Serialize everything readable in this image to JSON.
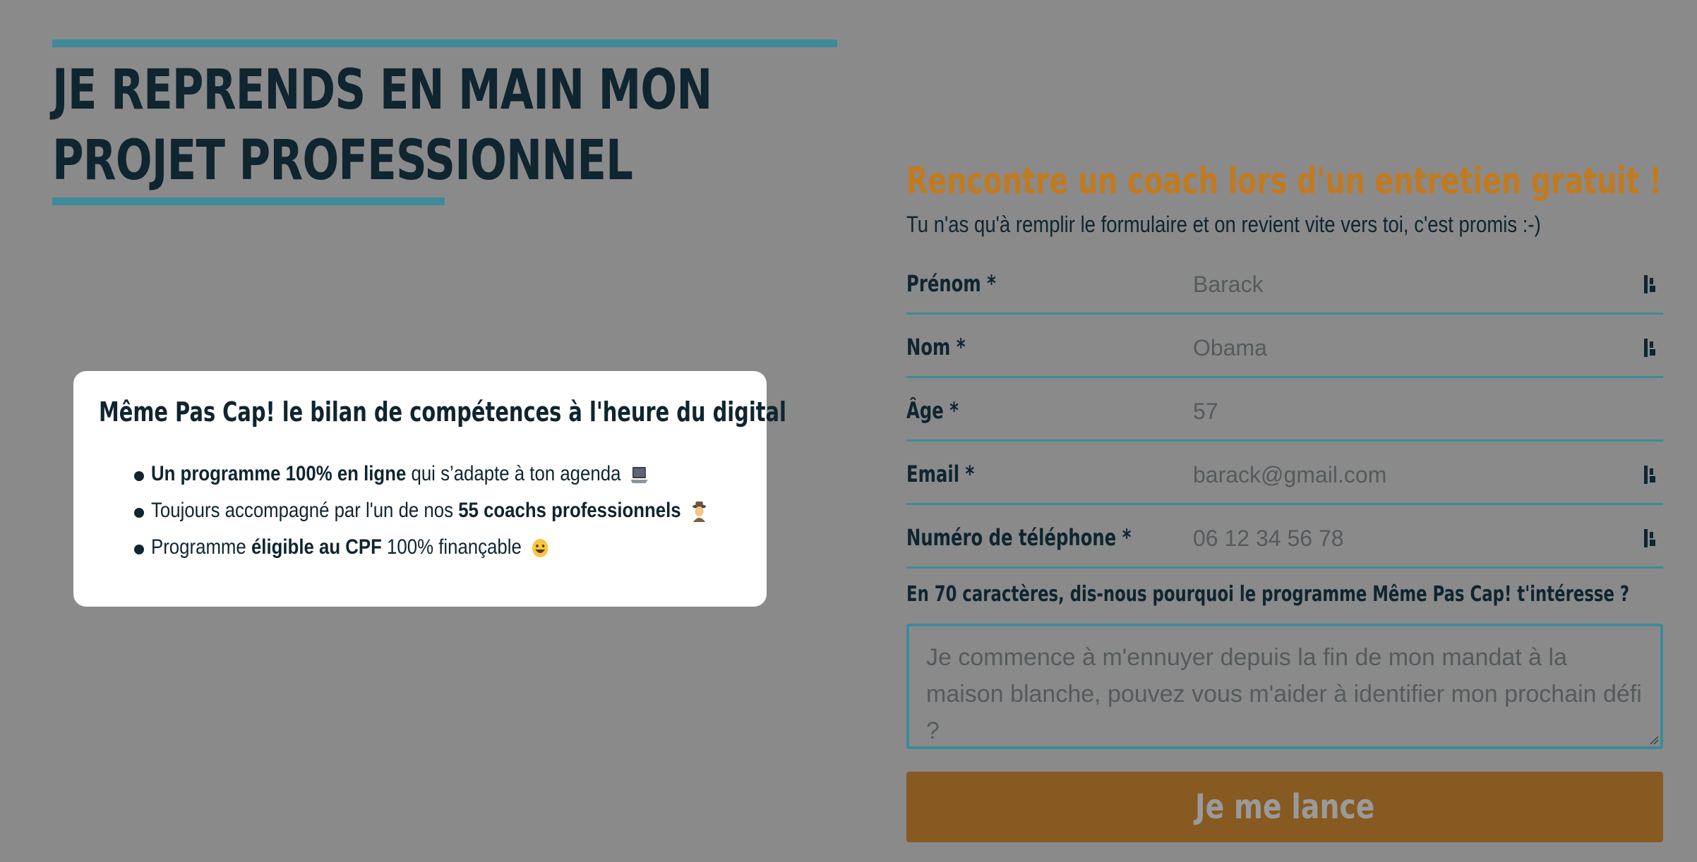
{
  "hero": {
    "title_line1": "JE REPRENDS EN MAIN MON",
    "title_line2": "PROJET PROFESSIONNEL"
  },
  "card": {
    "title": "Même Pas Cap! le bilan de compétences à l'heure du digital",
    "bullets": [
      {
        "bold": "Un programme 100% en ligne",
        "text": " qui s’adapte à ton agenda",
        "emoji": "laptop-icon"
      },
      {
        "pre": "Toujours accompagné par l'un de nos ",
        "bold": "55 coachs professionnels",
        "emoji": "detective-icon"
      },
      {
        "pre": "Programme ",
        "bold": "éligible au CPF",
        "text": " 100% finançable",
        "emoji": "grinning-face-icon"
      }
    ]
  },
  "form": {
    "heading": "Rencontre un coach lors d'un entretien gratuit !",
    "subheading": "Tu n'as qu'à remplir le formulaire et on revient vite vers toi, c'est promis :-)",
    "fields": [
      {
        "label": "Prénom *",
        "placeholder": "Barack"
      },
      {
        "label": "Nom *",
        "placeholder": "Obama"
      },
      {
        "label": "Âge *",
        "placeholder": "57"
      },
      {
        "label": "Email *",
        "placeholder": "barack@gmail.com"
      },
      {
        "label": "Numéro de téléphone *",
        "placeholder": "06 12 34 56 78"
      }
    ],
    "question": "En 70 caractères, dis-nous pourquoi le programme Même Pas Cap! t'intéresse ?",
    "textarea_placeholder": "Je commence à m'ennuyer depuis la fin de mon mandat à la maison blanche, pouvez vous m'aider à identifier mon prochain défi ?",
    "submit_label": "Je me lance"
  },
  "colors": {
    "overlay": "#8a8a8a",
    "accent_teal": "#3e8a98",
    "accent_orange": "#c27a1e",
    "button": "#875a22",
    "text_dark": "#0f2530"
  }
}
